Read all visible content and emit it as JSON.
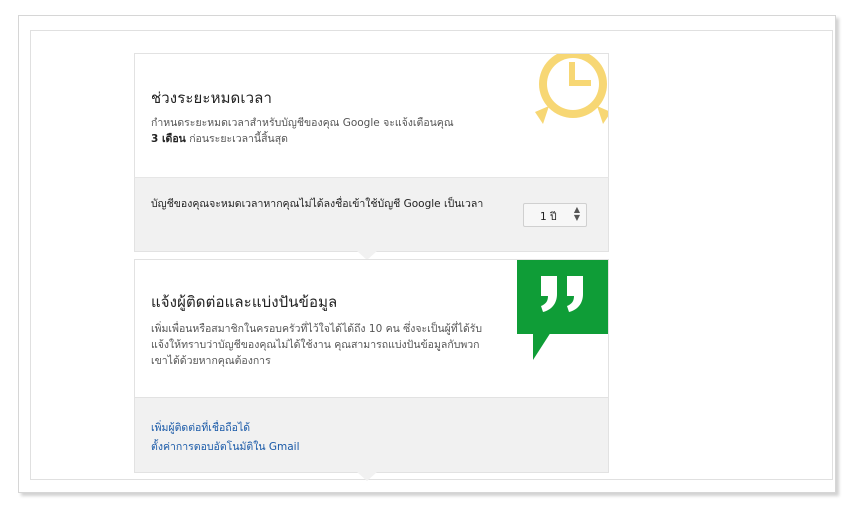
{
  "timeout_section": {
    "title": "ช่วงระยะหมดเวลา",
    "desc_line1": "กำหนดระยะหมดเวลาสำหรับบัญชีของคุณ Google จะแจ้งเตือนคุณ",
    "desc_bold": "3 เดือน",
    "desc_tail": " ก่อนระยะเวลานี้สิ้นสุด",
    "icon": "alarm-clock-icon",
    "icon_color": "#f7d774"
  },
  "timeout_setting": {
    "label": "บัญชีของคุณจะหมดเวลาหากคุณไม่ได้ลงชื่อเข้าใช้บัญชี Google เป็นเวลา",
    "select_value": "1 ปี"
  },
  "contacts_section": {
    "title": "แจ้งผู้ติดต่อและแบ่งปันข้อมูล",
    "desc": "เพิ่มเพื่อนหรือสมาชิกในครอบครัวที่ไว้ใจได้ได้ถึง 10 คน ซึ่งจะเป็นผู้ที่ได้รับแจ้งให้ทราบว่าบัญชีของคุณไม่ได้ใช้งาน คุณสามารถแบ่งปันข้อมูลกับพวกเขาได้ด้วยหากคุณต้องการ",
    "icon": "quote-bubble-icon",
    "icon_color": "#0f9d37"
  },
  "links": {
    "add_contact": "เพิ่มผู้ติดต่อที่เชื่อถือได้",
    "gmail_autoreply": "ตั้งค่าการตอบอัตโนมัติใน Gmail"
  }
}
